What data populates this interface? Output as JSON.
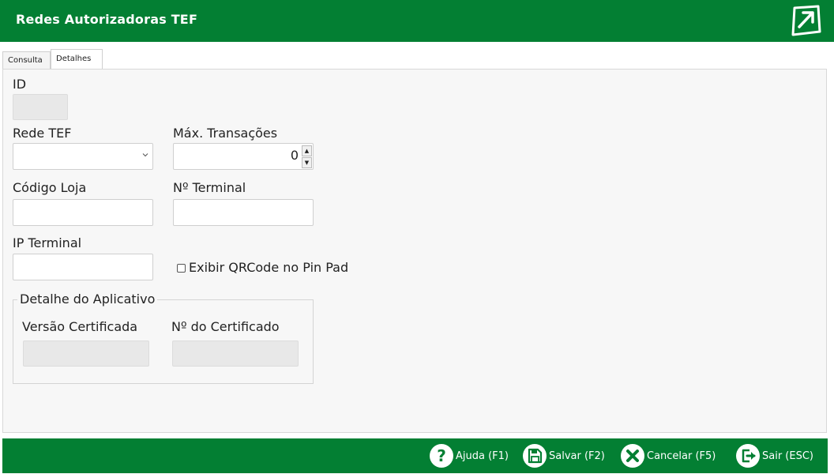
{
  "window": {
    "title": "Redes Autorizadoras TEF"
  },
  "tabs": [
    {
      "label": "Consulta"
    },
    {
      "label": "Detalhes"
    }
  ],
  "form": {
    "id_label": "ID",
    "rede_tef_label": "Rede TEF",
    "max_transacoes_label": "Máx. Transações",
    "max_transacoes_value": "0",
    "codigo_loja_label": "Código Loja",
    "n_terminal_label": "Nº Terminal",
    "ip_terminal_label": "IP Terminal",
    "qrcode_label": "Exibir QRCode no Pin Pad"
  },
  "app_detail": {
    "legend": "Detalhe do Aplicativo",
    "versao_label": "Versão Certificada",
    "n_cert_label": "Nº do Certificado"
  },
  "footer": {
    "help": "Ajuda (F1)",
    "save": "Salvar (F2)",
    "cancel": "Cancelar (F5)",
    "exit": "Sair (ESC)"
  },
  "colors": {
    "brand_green": "#037f33"
  }
}
